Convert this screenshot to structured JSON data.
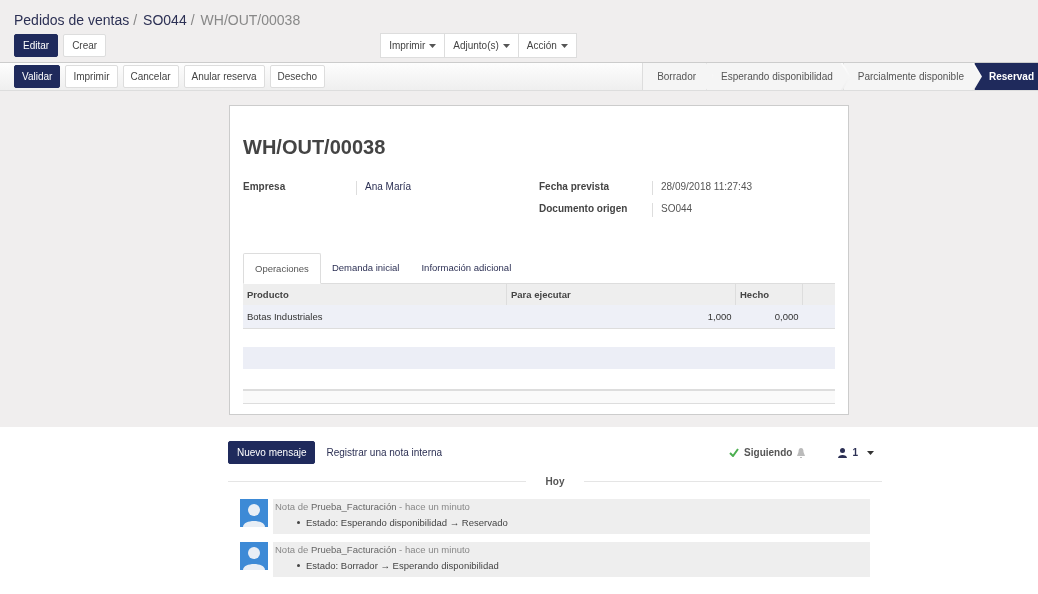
{
  "breadcrumb": [
    {
      "label": "Pedidos de ventas",
      "link": true
    },
    {
      "label": "SO044",
      "link": true
    },
    {
      "label": "WH/OUT/00038",
      "link": false
    }
  ],
  "breadcrumb_separator": "/",
  "main_buttons": [
    {
      "label": "Editar",
      "primary": true
    },
    {
      "label": "Crear",
      "primary": false
    }
  ],
  "dropdowns": [
    "Imprimir",
    "Adjunto(s)",
    "Acción"
  ],
  "action_buttons": [
    {
      "label": "Validar",
      "primary": true
    },
    {
      "label": "Imprimir",
      "primary": false
    },
    {
      "label": "Cancelar",
      "primary": false
    },
    {
      "label": "Anular reserva",
      "primary": false
    },
    {
      "label": "Desecho",
      "primary": false
    }
  ],
  "status_steps": [
    {
      "label": "Borrador",
      "selected": false
    },
    {
      "label": "Esperando disponibilidad",
      "selected": false
    },
    {
      "label": "Parcialmente disponible",
      "selected": false
    },
    {
      "label": "Reservad",
      "selected": true
    }
  ],
  "form": {
    "title": "WH/OUT/00038",
    "left_fields": [
      {
        "label": "Empresa",
        "value": "Ana María",
        "link": true
      }
    ],
    "right_fields": [
      {
        "label": "Fecha prevista",
        "value": "28/09/2018 11:27:43",
        "link": false
      },
      {
        "label": "Documento origen",
        "value": "SO044",
        "link": false
      }
    ],
    "tabs": [
      {
        "label": "Operaciones",
        "selected": true
      },
      {
        "label": "Demanda inicial",
        "selected": false
      },
      {
        "label": "Información adicional",
        "selected": false
      }
    ],
    "table": {
      "columns": [
        "Producto",
        "Para ejecutar",
        "Hecho"
      ],
      "rows": [
        [
          "Botas Industriales",
          "1,000",
          "0,000"
        ]
      ]
    }
  },
  "chatter": {
    "primary_button": "Nuevo mensaje",
    "note_link": "Registrar una nota interna",
    "following": "Siguiendo",
    "followers": "1",
    "separator": "Hoy",
    "messages": [
      {
        "header": "Nota de **Prueba_Facturación** - hace un minuto",
        "change": "Estado: Esperando disponibilidad → Reservado"
      },
      {
        "header": "Nota de **Prueba_Facturación** - hace un minuto",
        "change": "Estado: Borrador → Esperando disponibilidad"
      }
    ]
  }
}
